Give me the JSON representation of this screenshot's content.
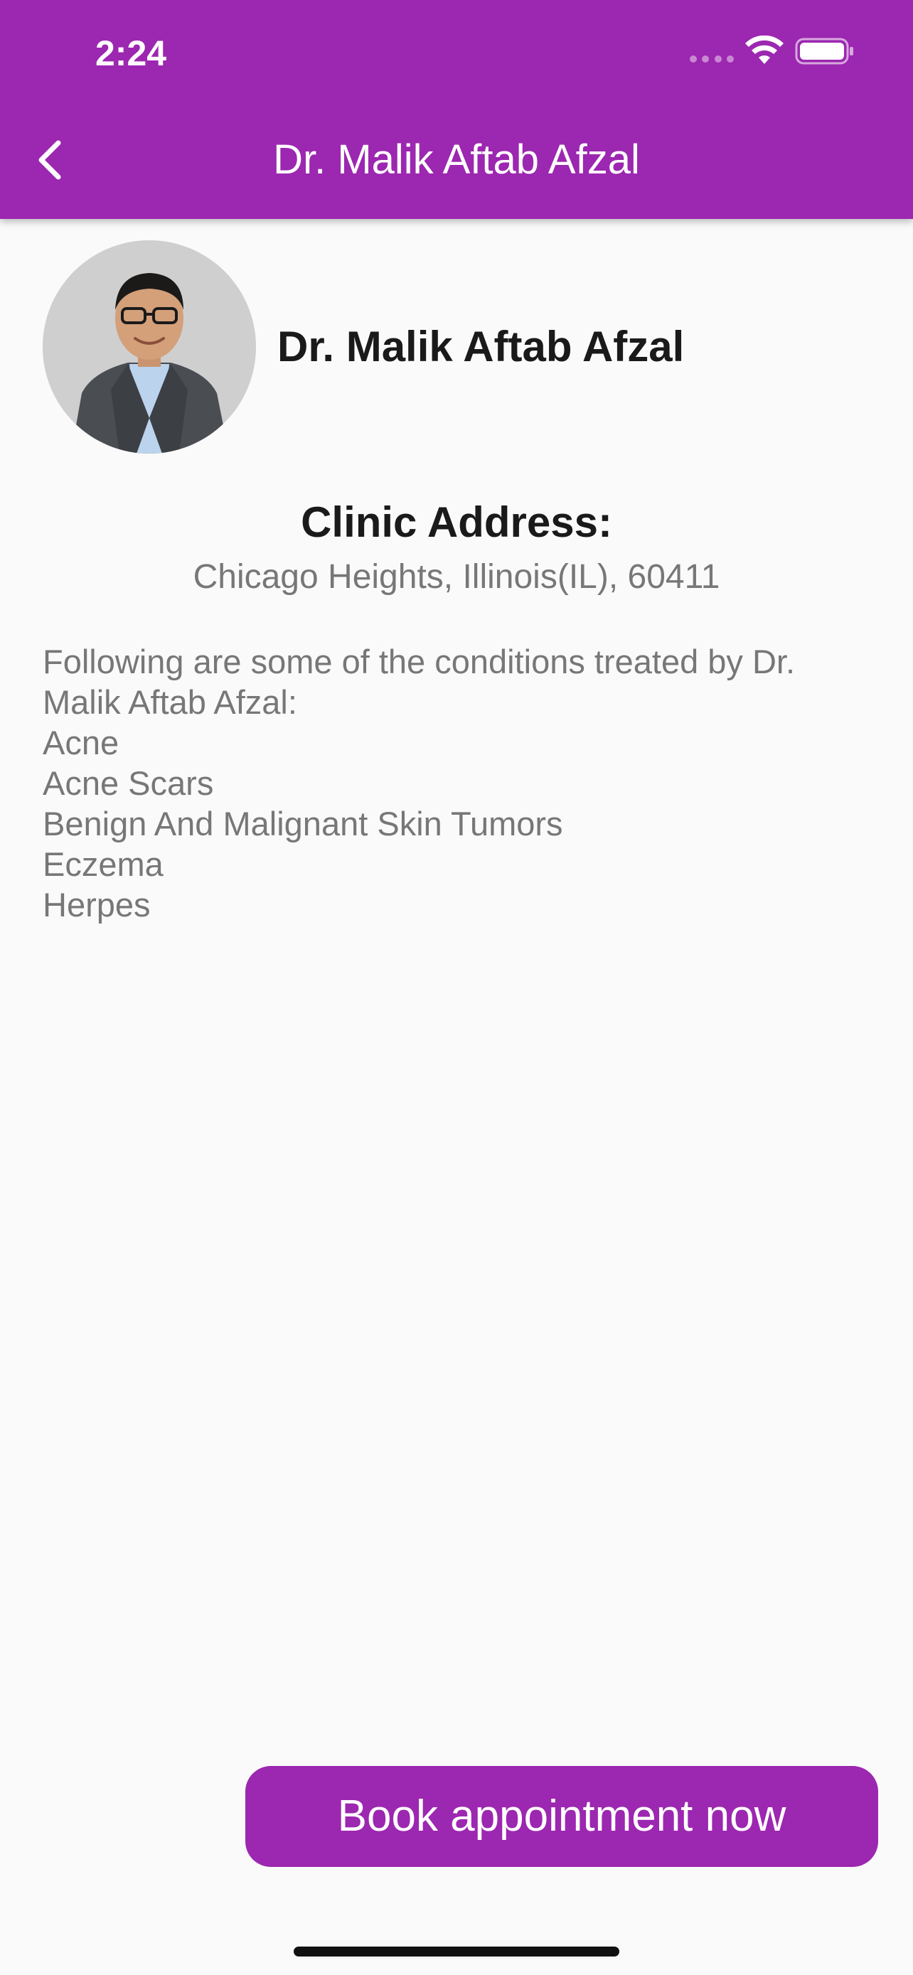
{
  "status_bar": {
    "time": "2:24"
  },
  "app_bar": {
    "title": "Dr. Malik Aftab Afzal",
    "background_color": "#9c27b0",
    "back_icon": "chevron-left-icon"
  },
  "profile": {
    "name": "Dr. Malik Aftab Afzal",
    "avatar_icon": "doctor-avatar"
  },
  "clinic": {
    "heading": "Clinic Address:",
    "address": "Chicago Heights, Illinois(IL), 60411"
  },
  "conditions": {
    "intro_line1": "Following are some of the conditions treated by Dr.",
    "intro_line2": "Malik Aftab Afzal:",
    "items": [
      "Acne",
      "Acne Scars",
      "Benign And Malignant Skin Tumors",
      "Eczema",
      "Herpes"
    ]
  },
  "actions": {
    "book_label": "Book appointment now",
    "button_color": "#9c27b0"
  }
}
